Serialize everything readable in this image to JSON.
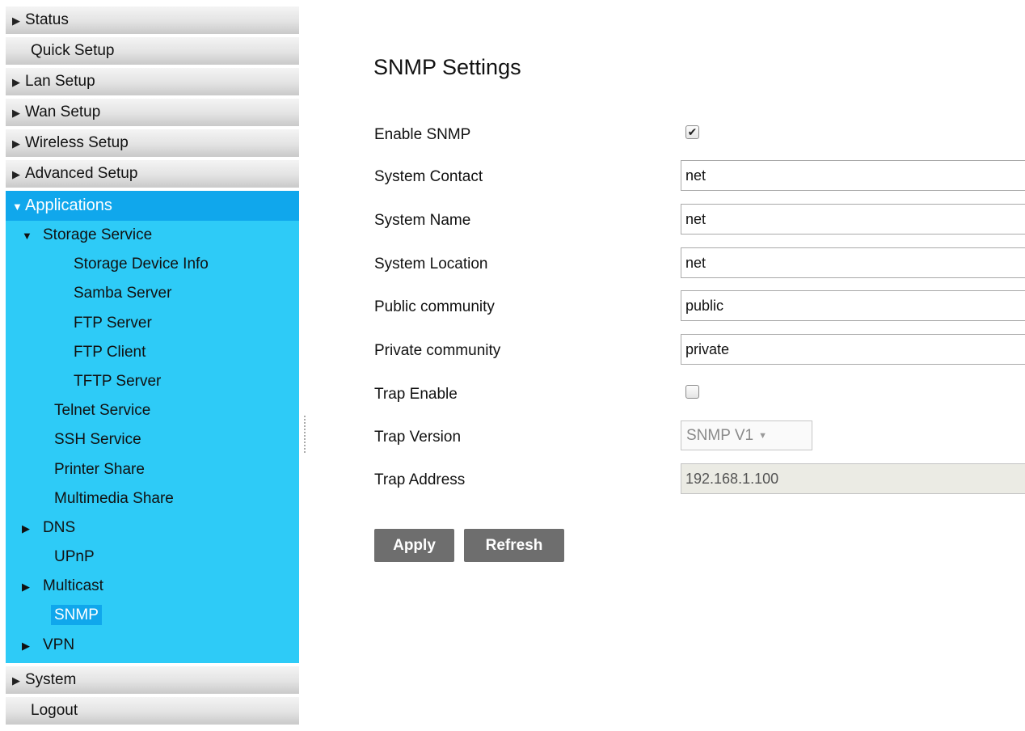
{
  "sidebar": {
    "status": "Status",
    "quick_setup": "Quick Setup",
    "lan_setup": "Lan Setup",
    "wan_setup": "Wan Setup",
    "wireless_setup": "Wireless Setup",
    "advanced_setup": "Advanced Setup",
    "applications": {
      "label": "Applications",
      "items": {
        "storage_service": "Storage Service",
        "storage_device_info": "Storage Device Info",
        "samba_server": "Samba Server",
        "ftp_server": "FTP Server",
        "ftp_client": "FTP Client",
        "tftp_server": "TFTP Server",
        "telnet_service": "Telnet Service",
        "ssh_service": "SSH Service",
        "printer_share": "Printer Share",
        "multimedia_share": "Multimedia Share",
        "dns": "DNS",
        "upnp": "UPnP",
        "multicast": "Multicast",
        "snmp": "SNMP",
        "vpn": "VPN"
      }
    },
    "system": "System",
    "logout": "Logout",
    "icons": {
      "collapsed": "triangle-right-icon",
      "expanded": "triangle-down-icon"
    }
  },
  "page": {
    "title": "SNMP Settings"
  },
  "form": {
    "enable_snmp": {
      "label": "Enable SNMP",
      "checked": true
    },
    "system_contact": {
      "label": "System Contact",
      "value": "net"
    },
    "system_name": {
      "label": "System Name",
      "value": "net"
    },
    "system_location": {
      "label": "System Location",
      "value": "net"
    },
    "public_community": {
      "label": "Public community",
      "value": "public"
    },
    "private_community": {
      "label": "Private community",
      "value": "private"
    },
    "trap_enable": {
      "label": "Trap Enable",
      "checked": false
    },
    "trap_version": {
      "label": "Trap Version",
      "value": "SNMP V1",
      "disabled": true
    },
    "trap_address": {
      "label": "Trap Address",
      "value": "192.168.1.100",
      "disabled": true
    }
  },
  "buttons": {
    "apply": "Apply",
    "refresh": "Refresh"
  },
  "colors": {
    "active_menu": "#10a7ec",
    "applications_panel": "#2ecbf7",
    "button": "#6e6e6e"
  }
}
